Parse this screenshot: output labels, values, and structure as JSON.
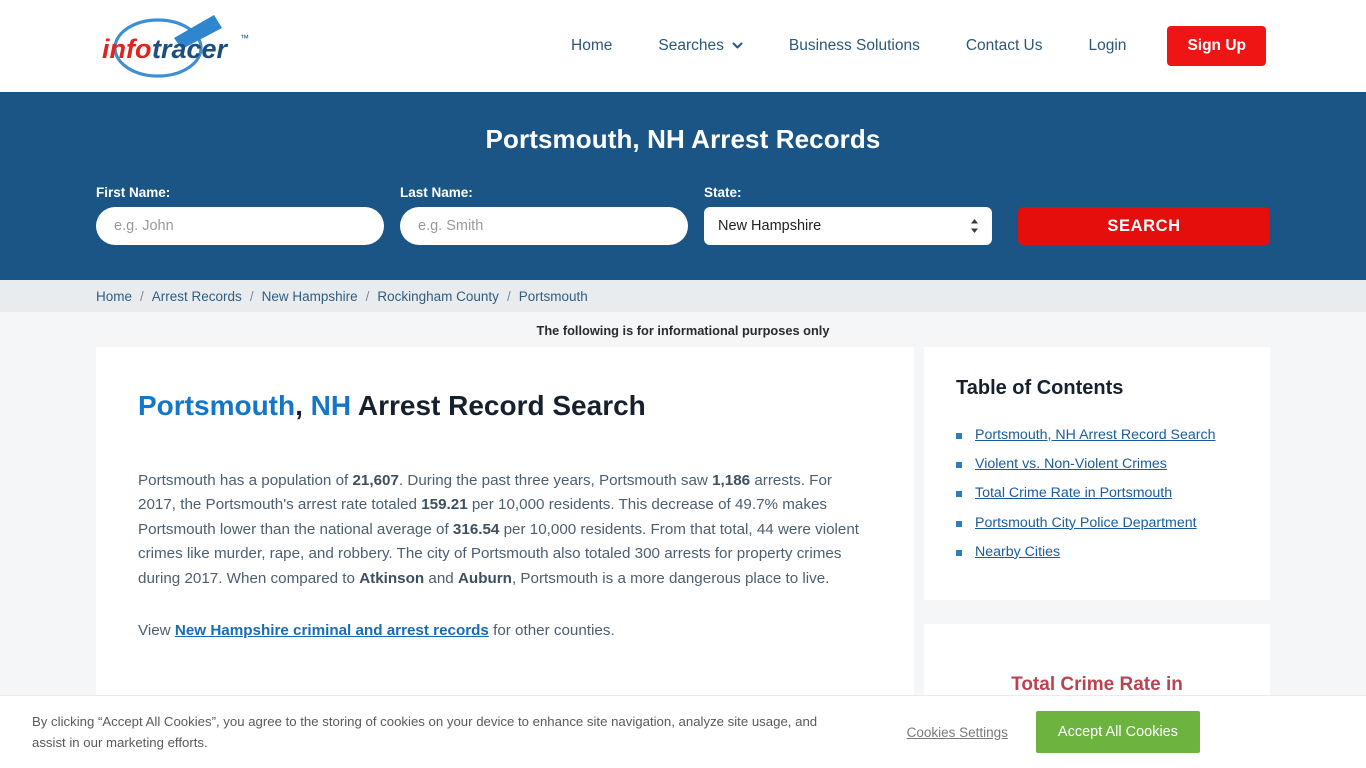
{
  "brand": {
    "name_part1": "info",
    "name_part2": "tracer",
    "trademark": "™",
    "red": "#e2231a",
    "blue": "#2e7cc0",
    "dark_blue": "#1c4f7c"
  },
  "nav": {
    "items": [
      {
        "label": "Home",
        "has_chevron": false,
        "icon": ""
      },
      {
        "label": "Searches",
        "has_chevron": true,
        "icon": "chevron-down-icon"
      },
      {
        "label": "Business Solutions",
        "has_chevron": false,
        "icon": ""
      },
      {
        "label": "Contact Us",
        "has_chevron": false,
        "icon": ""
      },
      {
        "label": "Login",
        "has_chevron": false,
        "icon": ""
      }
    ],
    "signup_label": "Sign Up",
    "signup_color": "#f01515"
  },
  "banner": {
    "title": "Portsmouth, NH Arrest Records",
    "background": "#1b5586",
    "first_name_label": "First Name:",
    "first_name_placeholder": "e.g. John",
    "first_name_value": "",
    "last_name_label": "Last Name:",
    "last_name_placeholder": "e.g. Smith",
    "last_name_value": "",
    "state_label": "State:",
    "state_value": "New Hampshire",
    "state_options": [
      "New Hampshire"
    ],
    "search_label": "SEARCH",
    "search_color": "#e60d0d"
  },
  "breadcrumb": {
    "separator": "/",
    "items": [
      "Home",
      "Arrest Records",
      "New Hampshire",
      "Rockingham County",
      "Portsmouth"
    ]
  },
  "notice": "The following is for informational purposes only",
  "main": {
    "title_city": "Portsmouth",
    "title_comma": ", ",
    "title_state": "NH",
    "title_rest": " Arrest Record Search",
    "paragraph1": {
      "s1": "Portsmouth has a population of ",
      "b1": "21,607",
      "s2": ". During the past three years, Portsmouth saw ",
      "b2": "1,186",
      "s3": " arrests. For 2017, the Portsmouth's arrest rate totaled ",
      "b3": "159.21",
      "s4": " per 10,000 residents. This decrease of 49.7% makes Portsmouth lower than the national average of ",
      "b4": "316.54",
      "s5": " per 10,000 residents. From that total, 44 were violent crimes like murder, rape, and robbery. The city of Portsmouth also totaled 300 arrests for property crimes during 2017. When compared to ",
      "b5": "Atkinson",
      "s6": " and ",
      "b6": "Auburn",
      "s7": ", Portsmouth is a more dangerous place to live."
    },
    "paragraph2": {
      "prefix": "View ",
      "link": "New Hampshire criminal and arrest records",
      "suffix": " for other counties."
    }
  },
  "sidebar": {
    "toc_title": "Table of Contents",
    "toc_items": [
      "Portsmouth, NH Arrest Record Search",
      "Violent vs. Non-Violent Crimes",
      "Total Crime Rate in Portsmouth",
      "Portsmouth City Police Department",
      "Nearby Cities"
    ],
    "crime_card_title": "Total Crime Rate in Portsmouth",
    "crime_card_color": "#bb4350"
  },
  "cookie": {
    "text": "By clicking “Accept All Cookies”, you agree to the storing of cookies on your device to enhance site navigation, analyze site usage, and assist in our marketing efforts.",
    "settings_label": "Cookies Settings",
    "accept_label": "Accept All Cookies",
    "accept_color": "#6cb33f"
  }
}
